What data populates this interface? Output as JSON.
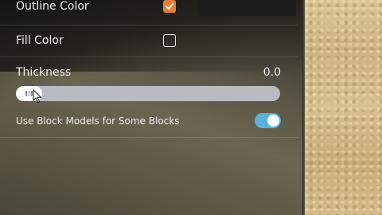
{
  "settings": {
    "outline_color": {
      "label": "Outline Color",
      "checked": true,
      "swatch_color": "#1d1d1c"
    },
    "fill_color": {
      "label": "Fill Color",
      "checked": false
    },
    "thickness": {
      "label": "Thickness",
      "value": "0.0",
      "fill_fraction": 0.0
    },
    "use_block_models": {
      "label": "Use Block Models for Some Blocks",
      "enabled": true
    }
  },
  "colors": {
    "accent_checkbox": "#e57f3a",
    "toggle_on": "#5cb2d6",
    "slider_track": "#b8bcc2"
  },
  "icons": {
    "checkmark": "checkmark-icon",
    "cursor": "mouse-cursor-icon"
  }
}
